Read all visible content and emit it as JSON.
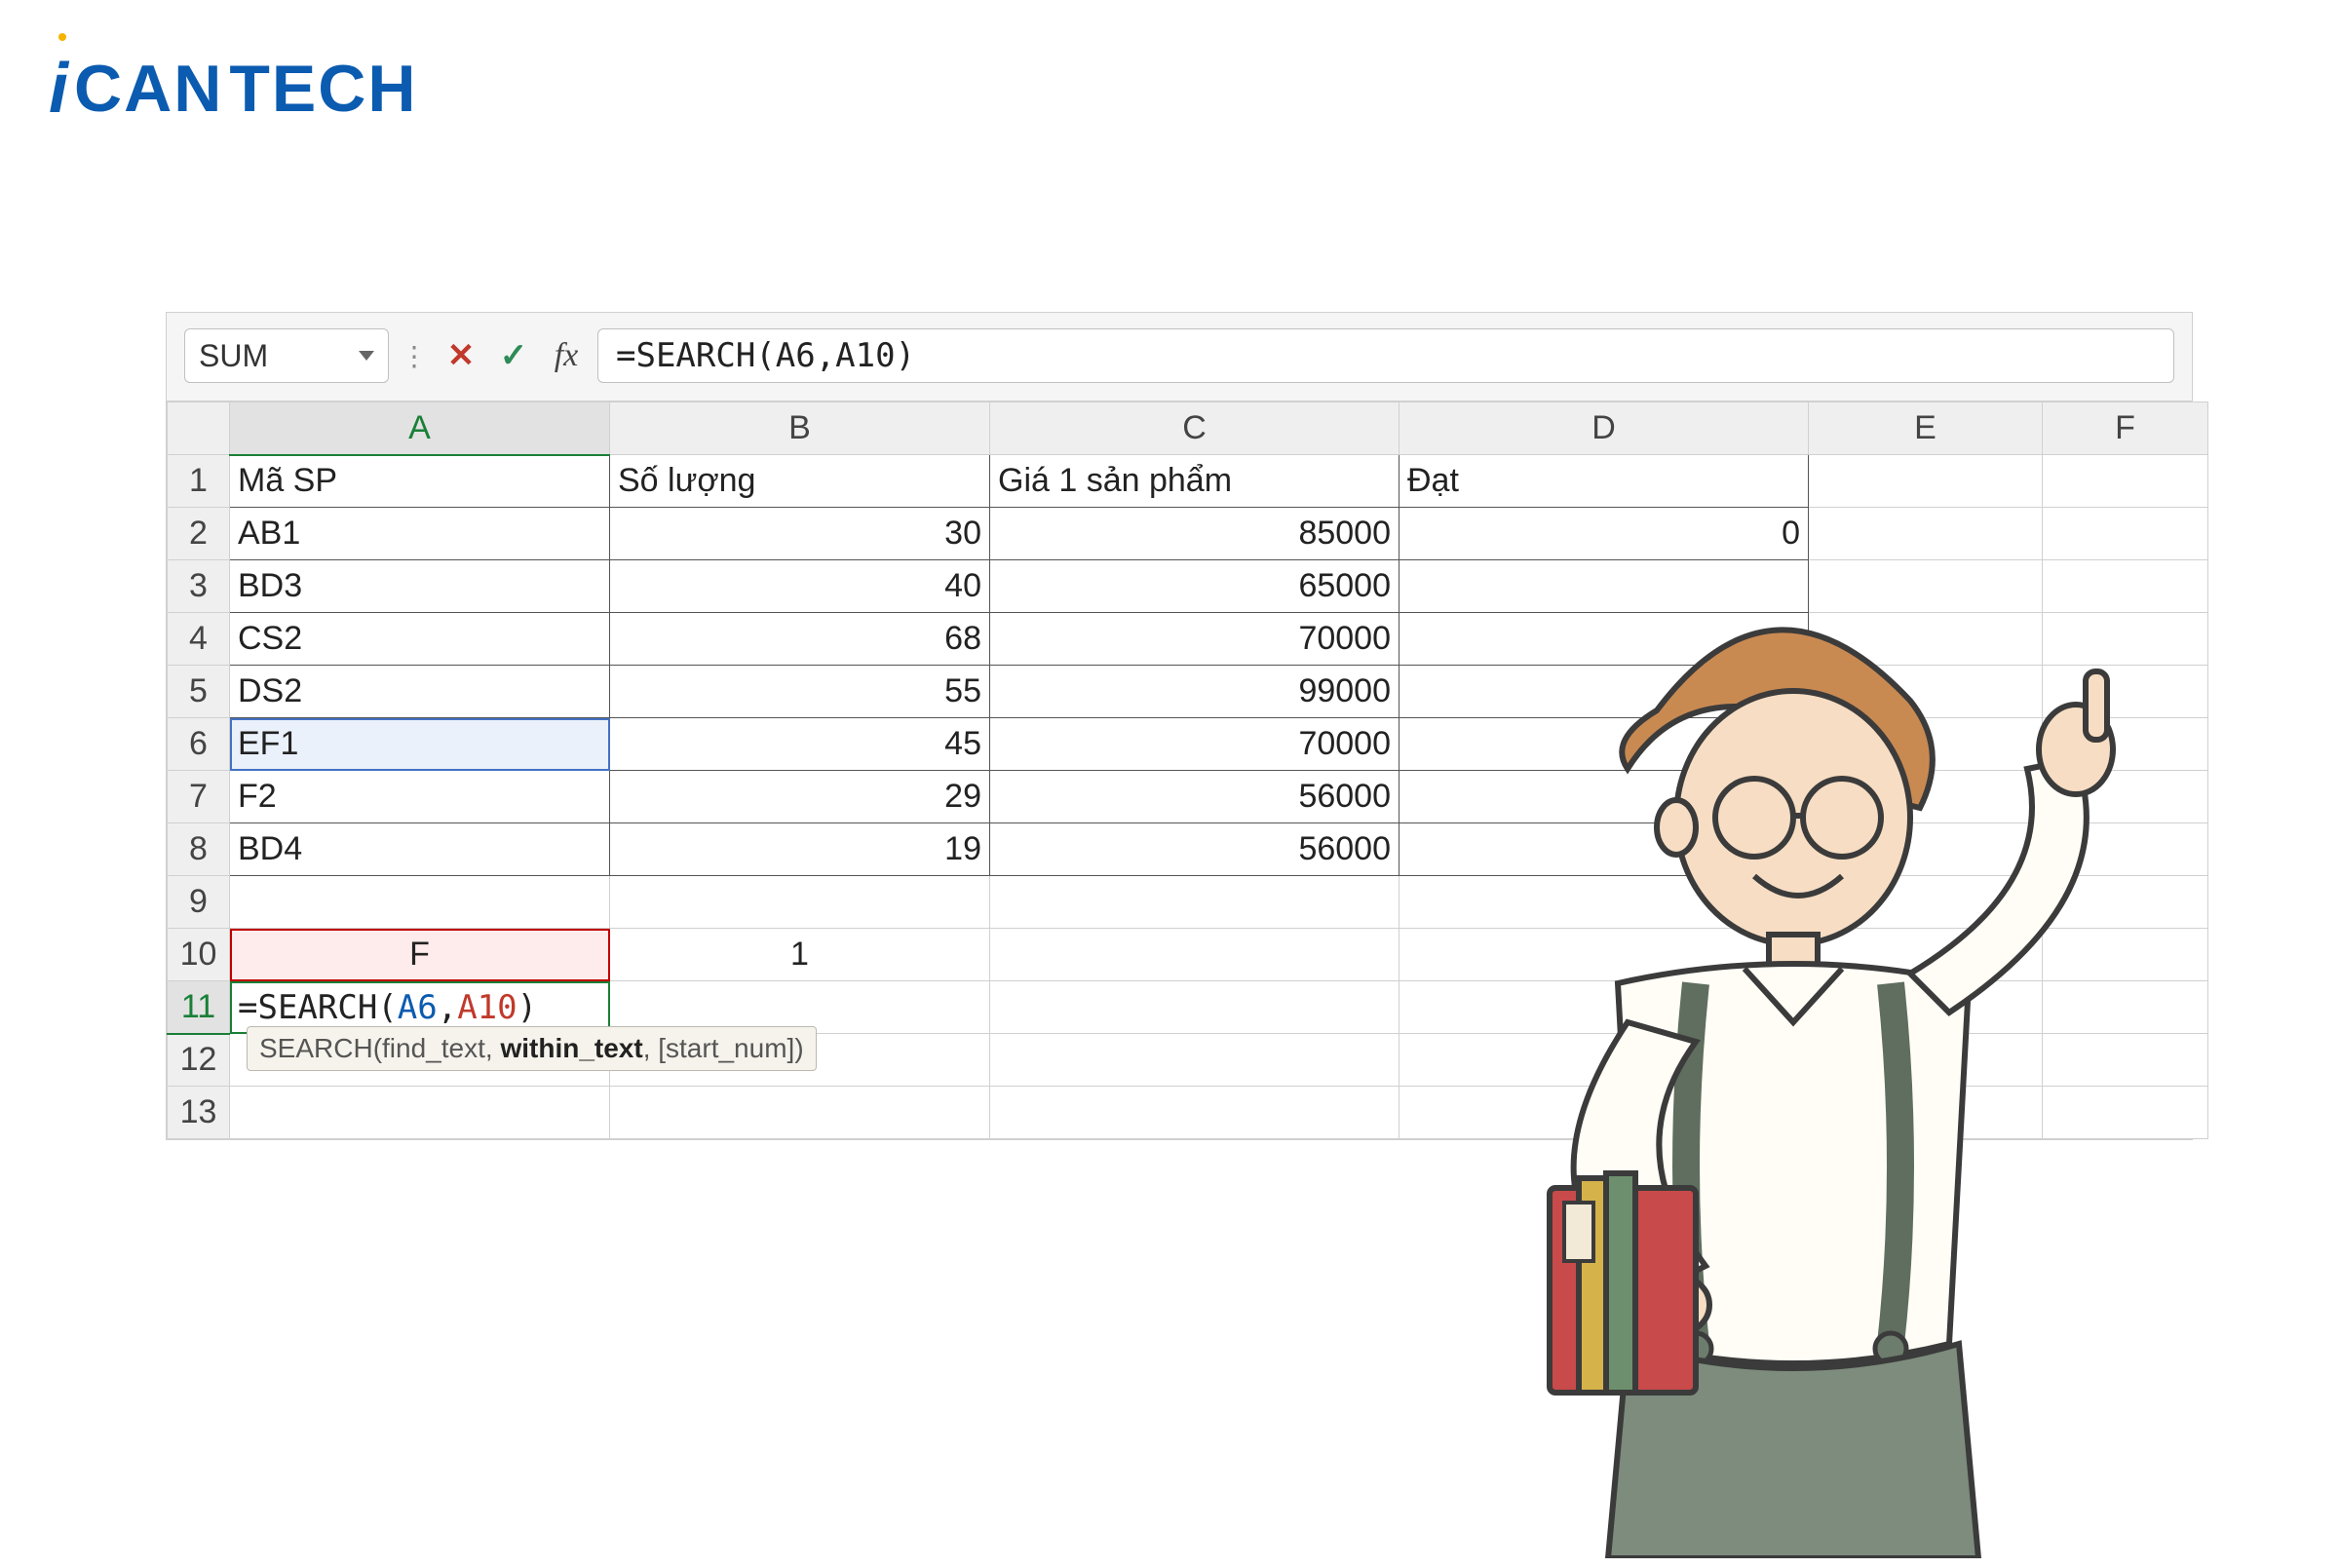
{
  "logo": {
    "i": "i",
    "can": "CAN",
    "tech": "TECH"
  },
  "formula_bar": {
    "namebox": "SUM",
    "cancel_glyph": "✕",
    "enter_glyph": "✓",
    "fx_glyph": "fx",
    "formula": "=SEARCH(A6,A10)"
  },
  "columns": [
    "A",
    "B",
    "C",
    "D",
    "E",
    "F"
  ],
  "col_widths_class": [
    "cA",
    "cB",
    "cC",
    "cD",
    "cE",
    "cF"
  ],
  "headers": {
    "A": "Mã SP",
    "B": "Số lượng",
    "C": "Giá 1 sản phẩm",
    "D": "Đạt"
  },
  "rows": [
    {
      "n": 1,
      "A": "Mã SP",
      "B": "Số lượng",
      "C": "Giá 1 sản phẩm",
      "D": "Đạt"
    },
    {
      "n": 2,
      "A": "AB1",
      "B": 30,
      "C": 85000,
      "D": 0
    },
    {
      "n": 3,
      "A": "BD3",
      "B": 40,
      "C": 65000
    },
    {
      "n": 4,
      "A": "CS2",
      "B": 68,
      "C": 70000
    },
    {
      "n": 5,
      "A": "DS2",
      "B": 55,
      "C": 99000
    },
    {
      "n": 6,
      "A": "EF1",
      "B": 45,
      "C": 70000
    },
    {
      "n": 7,
      "A": "F2",
      "B": 29,
      "C": 56000
    },
    {
      "n": 8,
      "A": "BD4",
      "B": 19,
      "C": 56000
    },
    {
      "n": 9
    },
    {
      "n": 10,
      "A": "F",
      "B": 1
    },
    {
      "n": 11,
      "A_formula": {
        "pre": "=SEARCH(",
        "arg1": "A6",
        "sep": ",",
        "arg2": "A10",
        "post": ")"
      }
    },
    {
      "n": 12
    },
    {
      "n": 13
    }
  ],
  "tooltip": {
    "fn": "SEARCH",
    "arg1": "find_text",
    "arg2": "within_text",
    "arg3": "[start_num]"
  }
}
